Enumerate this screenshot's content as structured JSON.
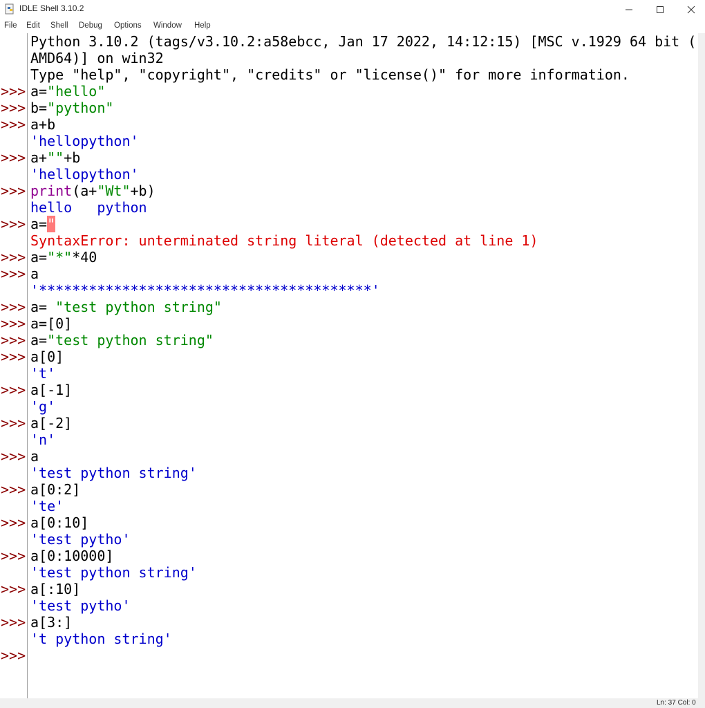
{
  "window": {
    "title": "IDLE Shell 3.10.2",
    "controls": {
      "minimize": "minimize-icon",
      "maximize": "maximize-icon",
      "close": "close-icon"
    }
  },
  "menu": [
    "File",
    "Edit",
    "Shell",
    "Debug",
    "Options",
    "Window",
    "Help"
  ],
  "banner": [
    "Python 3.10.2 (tags/v3.10.2:a58ebcc, Jan 17 2022, 14:12:15) [MSC v.1929 64 bit (",
    "AMD64)] on win32",
    "Type \"help\", \"copyright\", \"credits\" or \"license()\" for more information."
  ],
  "prompt_symbol": ">>>",
  "session": [
    {
      "code": [
        "a=",
        "\"hello\""
      ]
    },
    {
      "code": [
        "b=",
        "\"python\""
      ]
    },
    {
      "code": [
        "a+b"
      ],
      "output": "'hellopython'"
    },
    {
      "code": [
        "a+",
        "\"\"",
        "+b"
      ],
      "output": "'hellopython'"
    },
    {
      "code": [
        "print",
        "(a+",
        "\"Wt\"",
        "+b)"
      ],
      "output": "hello   python"
    },
    {
      "code": [
        "a=",
        "\""
      ],
      "error": "SyntaxError: unterminated string literal (detected at line 1)"
    },
    {
      "code": [
        "a=",
        "\"*\"",
        "*40"
      ]
    },
    {
      "code": [
        "a"
      ],
      "output": "'****************************************'"
    },
    {
      "code": [
        "a= ",
        "\"test python string\""
      ]
    },
    {
      "code": [
        "a=[0]"
      ]
    },
    {
      "code": [
        "a=",
        "\"test python string\""
      ]
    },
    {
      "code": [
        "a[0]"
      ],
      "output": "'t'"
    },
    {
      "code": [
        "a[-1]"
      ],
      "output": "'g'"
    },
    {
      "code": [
        "a[-2]"
      ],
      "output": "'n'"
    },
    {
      "code": [
        "a"
      ],
      "output": "'test python string'"
    },
    {
      "code": [
        "a[0:2]"
      ],
      "output": "'te'"
    },
    {
      "code": [
        "a[0:10]"
      ],
      "output": "'test pytho'"
    },
    {
      "code": [
        "a[0:10000]"
      ],
      "output": "'test python string'"
    },
    {
      "code": [
        "a[:10]"
      ],
      "output": "'test pytho'"
    },
    {
      "code": [
        "a[3:]"
      ],
      "output": "'t python string'"
    }
  ],
  "status": {
    "position": "Ln: 37  Col: 0"
  },
  "colors": {
    "prompt": "#8b0000",
    "string": "#008800",
    "output": "#0000cc",
    "error": "#dd0000",
    "builtin": "#900090"
  }
}
